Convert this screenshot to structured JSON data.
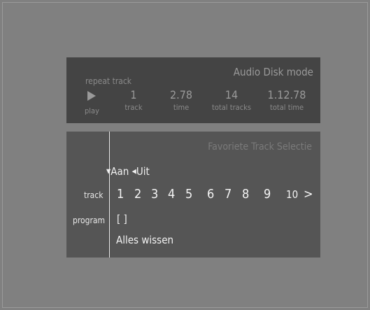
{
  "status": {
    "mode": "Audio Disk mode",
    "repeat": "repeat track",
    "play_label": "play",
    "columns": [
      {
        "value": "1",
        "label": "track"
      },
      {
        "value": "2.78",
        "label": "time"
      },
      {
        "value": "14",
        "label": "total tracks"
      },
      {
        "value": "1.12.78",
        "label": "total time"
      }
    ]
  },
  "selection": {
    "title": "Favoriete Track Selectie",
    "on_label": "Aan",
    "off_label": "Uit",
    "track_label": "track",
    "program_label": "program",
    "tracks": [
      "1",
      "2",
      "3",
      "4",
      "5",
      "6",
      "7",
      "8",
      "9",
      "10"
    ],
    "next": ">",
    "program_value": "[ ]",
    "clear_label": "Alles wissen"
  }
}
